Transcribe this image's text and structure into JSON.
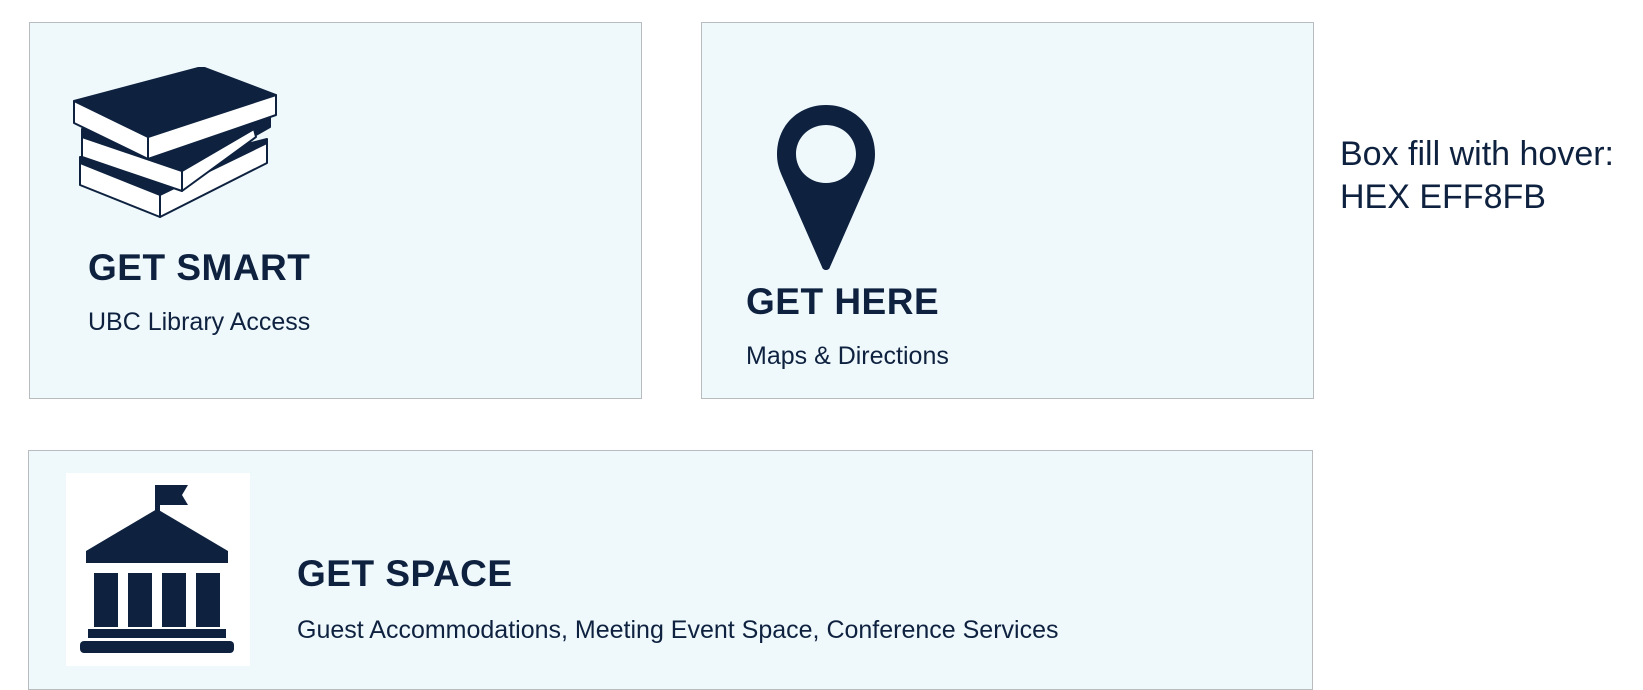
{
  "colors": {
    "box_fill": "#EFF8FB",
    "box_border": "#B9BCBF",
    "navy": "#0E2240"
  },
  "cards": {
    "smart": {
      "title": "GET SMART",
      "subtitle": "UBC Library Access",
      "icon": "books-icon"
    },
    "here": {
      "title": "GET HERE",
      "subtitle": "Maps & Directions",
      "icon": "map-pin-icon"
    },
    "space": {
      "title": "GET SPACE",
      "subtitle": "Guest Accommodations, Meeting Event Space, Conference Services",
      "icon": "building-icon"
    }
  },
  "note": {
    "line1": "Box fill with hover:",
    "line2": "HEX EFF8FB"
  }
}
